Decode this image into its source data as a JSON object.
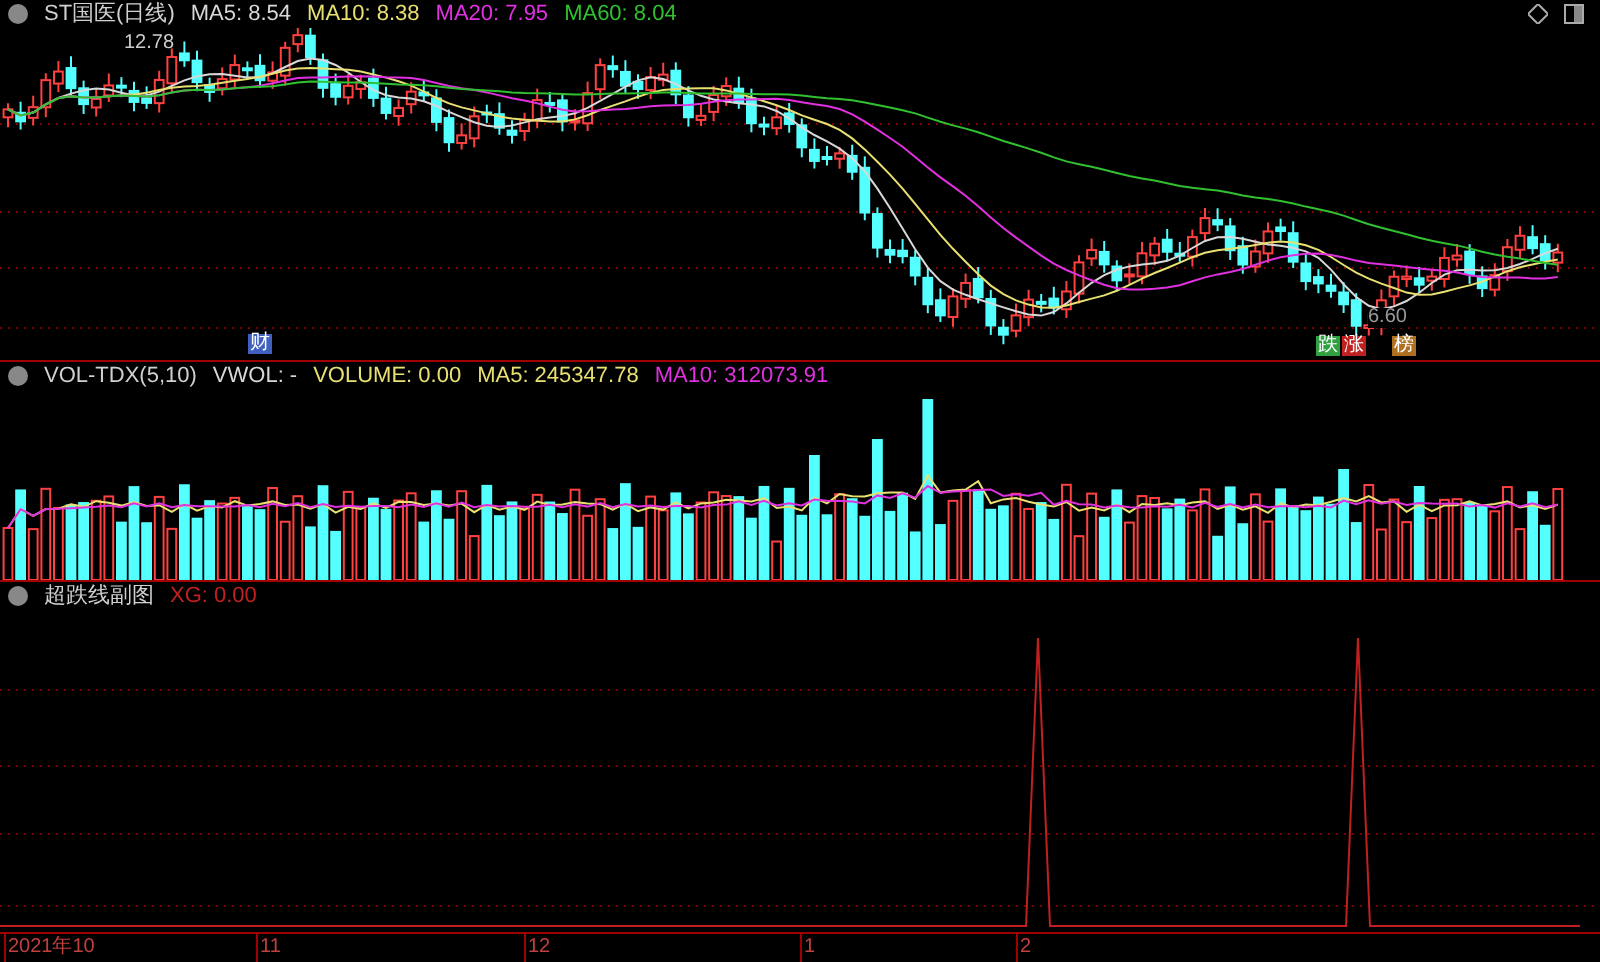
{
  "main_panel": {
    "title": "ST国医(日线)",
    "indicators": [
      {
        "label": "MA5: 8.54",
        "color": "#d8d8d8"
      },
      {
        "label": "MA10: 8.38",
        "color": "#e8e070"
      },
      {
        "label": "MA20: 7.95",
        "color": "#e030e0"
      },
      {
        "label": "MA60: 8.04",
        "color": "#30c030"
      }
    ],
    "high_label": "12.78",
    "low_label": "6.60",
    "event_markers": [
      {
        "text": "财",
        "color": "#4060c0"
      }
    ],
    "badges": [
      {
        "text": "跌",
        "color": "#30a040"
      },
      {
        "text": "涨",
        "color": "#c02020"
      },
      {
        "text": "榜",
        "color": "#b07020"
      }
    ]
  },
  "volume_panel": {
    "title": "VOL-TDX(5,10)",
    "readings": [
      {
        "label": "VWOL: -",
        "color": "#d8d8d8"
      },
      {
        "label": "VOLUME: 0.00",
        "color": "#e8e070"
      },
      {
        "label": "MA5: 245347.78",
        "color": "#e8e070"
      },
      {
        "label": "MA10: 312073.91",
        "color": "#e030e0"
      }
    ]
  },
  "sub_panel": {
    "title": "超跌线副图",
    "readings": [
      {
        "label": "XG: 0.00",
        "color": "#c02020"
      }
    ]
  },
  "x_axis": {
    "labels": [
      "2021年10",
      "11",
      "12",
      "1",
      "2"
    ]
  }
}
